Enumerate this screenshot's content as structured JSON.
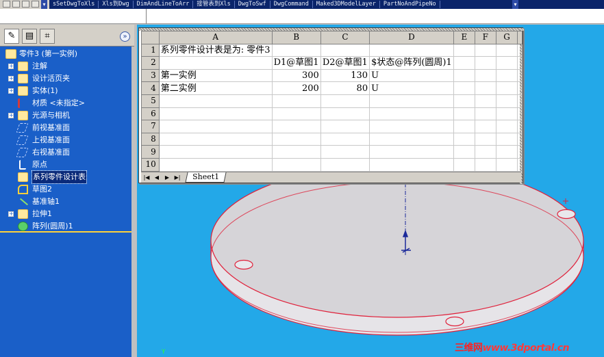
{
  "toolbar": {
    "items": [
      "sSetDwgToXls",
      "Xls到Dwg",
      "DimAndLineToArr",
      "接管表到Xls",
      "DwgToSwf",
      "DwgCommand",
      "Maked3DModelLayer",
      "PartNoAndPipeNo"
    ]
  },
  "feature_tree": {
    "tabs": [
      "feature-manager",
      "property-manager",
      "configuration-manager"
    ],
    "root": "零件3   (第一实例)",
    "items": [
      {
        "label": "注解",
        "icon": "annotations-icon",
        "expandable": true
      },
      {
        "label": "设计活页夹",
        "icon": "design-binder-icon",
        "expandable": true
      },
      {
        "label": "实体(1)",
        "icon": "solid-bodies-icon",
        "expandable": true
      },
      {
        "label": "材质 <未指定>",
        "icon": "material-icon",
        "expandable": false
      },
      {
        "label": "光源与相机",
        "icon": "lights-cameras-icon",
        "expandable": true
      },
      {
        "label": "前视基准面",
        "icon": "plane-icon",
        "expandable": false
      },
      {
        "label": "上视基准面",
        "icon": "plane-icon",
        "expandable": false
      },
      {
        "label": "右视基准面",
        "icon": "plane-icon",
        "expandable": false
      },
      {
        "label": "原点",
        "icon": "origin-icon",
        "expandable": false
      },
      {
        "label": "系列零件设计表",
        "icon": "design-table-icon",
        "expandable": false,
        "selected": true
      },
      {
        "label": "草图2",
        "icon": "sketch-icon",
        "expandable": false
      },
      {
        "label": "基准轴1",
        "icon": "axis-icon",
        "expandable": false
      },
      {
        "label": "拉伸1",
        "icon": "extrude-icon",
        "expandable": true
      },
      {
        "label": "阵列(圆周)1",
        "icon": "circular-pattern-icon",
        "expandable": false
      }
    ]
  },
  "spreadsheet": {
    "columns": [
      "A",
      "B",
      "C",
      "D",
      "E",
      "F",
      "G"
    ],
    "rows": [
      {
        "n": "1",
        "cells": [
          "系列零件设计表是为:  零件3",
          "",
          "",
          "",
          "",
          "",
          ""
        ]
      },
      {
        "n": "2",
        "cells": [
          "",
          "D1@草图1",
          "D2@草图1",
          "$状态@阵列(圆周)1",
          "",
          "",
          ""
        ]
      },
      {
        "n": "3",
        "cells": [
          "第一实例",
          "300",
          "130",
          "U",
          "",
          "",
          ""
        ]
      },
      {
        "n": "4",
        "cells": [
          "第二实例",
          "200",
          "80",
          "U",
          "",
          "",
          ""
        ]
      },
      {
        "n": "5",
        "cells": [
          "",
          "",
          "",
          "",
          "",
          "",
          ""
        ]
      },
      {
        "n": "6",
        "cells": [
          "",
          "",
          "",
          "",
          "",
          "",
          ""
        ]
      },
      {
        "n": "7",
        "cells": [
          "",
          "",
          "",
          "",
          "",
          "",
          ""
        ]
      },
      {
        "n": "8",
        "cells": [
          "",
          "",
          "",
          "",
          "",
          "",
          ""
        ]
      },
      {
        "n": "9",
        "cells": [
          "",
          "",
          "",
          "",
          "",
          "",
          ""
        ]
      },
      {
        "n": "10",
        "cells": [
          "",
          "",
          "",
          "",
          "",
          "",
          ""
        ]
      }
    ],
    "sheet_tab": "Sheet1",
    "nav": [
      "|◀",
      "◀",
      "▶",
      "▶|"
    ]
  },
  "viewport": {
    "axis_label": "Y",
    "watermark_cn": "三维网",
    "watermark_url": "www.3dportal.cn",
    "colors": {
      "background": "#23a8e8",
      "disc_top": "#d6d4d8",
      "edge": "#e0203a"
    }
  }
}
